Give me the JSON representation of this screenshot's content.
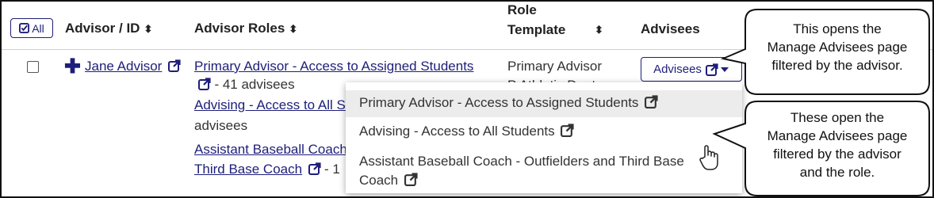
{
  "header": {
    "all_label": "All",
    "advisor_col": "Advisor / ID",
    "roles_col": "Advisor Roles",
    "template_col_line1": "Role",
    "template_col_line2": "Template",
    "advisees_col": "Advisees"
  },
  "row": {
    "advisor_name": "Jane Advisor",
    "roles": [
      {
        "text": "Primary Advisor - Access to Assigned Students",
        "count": "- 41 advisees"
      },
      {
        "text": "Advising - Access to All S",
        "count": "advisees"
      },
      {
        "text": "Assistant Baseball Coach",
        "count": ""
      },
      {
        "text": "Third Base Coach",
        "count": "- 1"
      }
    ],
    "role_template_line1": "Primary Advisor",
    "role_template_line2": "P   Athletic Dept",
    "advisees_button": "Advisees"
  },
  "dropdown": {
    "items": [
      {
        "label": "Primary Advisor - Access to Assigned Students"
      },
      {
        "label": "Advising - Access to All Students"
      },
      {
        "label_line1": "Assistant Baseball Coach - Outfielders and Third Base",
        "label_line2": "Coach"
      }
    ]
  },
  "callouts": {
    "top": {
      "line1": "This opens the",
      "line2": "Manage Advisees page",
      "line3": "filtered by the advisor."
    },
    "bottom": {
      "line1": "These open the",
      "line2": "Manage Advisees page",
      "line3": "filtered by the advisor",
      "line4": "and the role."
    }
  },
  "colors": {
    "link": "#1e1e7a",
    "border": "#111111",
    "highlight": "#ececec"
  },
  "icons": [
    "check-square-icon",
    "sort-icon",
    "plus-icon",
    "external-link-icon",
    "caret-down-icon",
    "hand-cursor-icon"
  ]
}
